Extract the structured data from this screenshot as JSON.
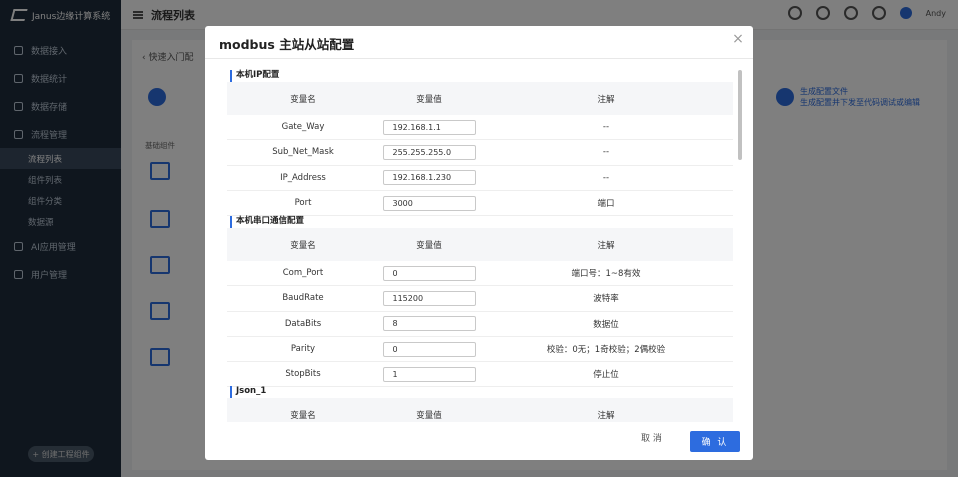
{
  "app": {
    "logo_text": "Janus边缘计算系统",
    "page_title": "流程列表",
    "user_name": "Andy",
    "breadcrumb_back": "快速入门配",
    "step_right_title": "生成配置文件",
    "step_right_desc": "生成配置并下发至代码调试或编辑",
    "component_label": "基础组件",
    "sidebar_add_button": "+ 创建工程组件"
  },
  "sidebar": {
    "items": [
      {
        "label": "数据接入"
      },
      {
        "label": "数据统计"
      },
      {
        "label": "数据存储"
      },
      {
        "label": "流程管理"
      }
    ],
    "subitems": [
      {
        "label": "流程列表",
        "active": true
      },
      {
        "label": "组件列表",
        "active": false
      },
      {
        "label": "组件分类",
        "active": false
      },
      {
        "label": "数据源",
        "active": false
      }
    ],
    "bottom_items": [
      {
        "label": "AI应用管理"
      },
      {
        "label": "用户管理"
      }
    ]
  },
  "modal": {
    "title": "modbus 主站从站配置",
    "close_icon": "×",
    "cancel_label": "取 消",
    "confirm_label": "确 认",
    "sections": [
      {
        "title": "本机IP配置",
        "headers": [
          "变量名",
          "变量值",
          "注解"
        ],
        "rows": [
          {
            "name": "Gate_Way",
            "value": "192.168.1.1",
            "note": "--"
          },
          {
            "name": "Sub_Net_Mask",
            "value": "255.255.255.0",
            "note": "--"
          },
          {
            "name": "IP_Address",
            "value": "192.168.1.230",
            "note": "--"
          },
          {
            "name": "Port",
            "value": "3000",
            "note": "端口"
          }
        ]
      },
      {
        "title": "本机串口通信配置",
        "headers": [
          "变量名",
          "变量值",
          "注解"
        ],
        "rows": [
          {
            "name": "Com_Port",
            "value": "0",
            "note": "端口号：1~8有效"
          },
          {
            "name": "BaudRate",
            "value": "115200",
            "note": "波特率"
          },
          {
            "name": "DataBits",
            "value": "8",
            "note": "数据位"
          },
          {
            "name": "Parity",
            "value": "0",
            "note": "校验：0无；1奇校验；2偶校验"
          },
          {
            "name": "StopBits",
            "value": "1",
            "note": "停止位"
          }
        ]
      },
      {
        "title": "Json_1",
        "headers": [
          "变量名",
          "变量值",
          "注解"
        ],
        "rows": []
      }
    ]
  },
  "colors": {
    "accent": "#2d6cdf",
    "sidebar_bg": "#1f2d3d",
    "overlay": "rgba(0,0,0,0.5)"
  }
}
